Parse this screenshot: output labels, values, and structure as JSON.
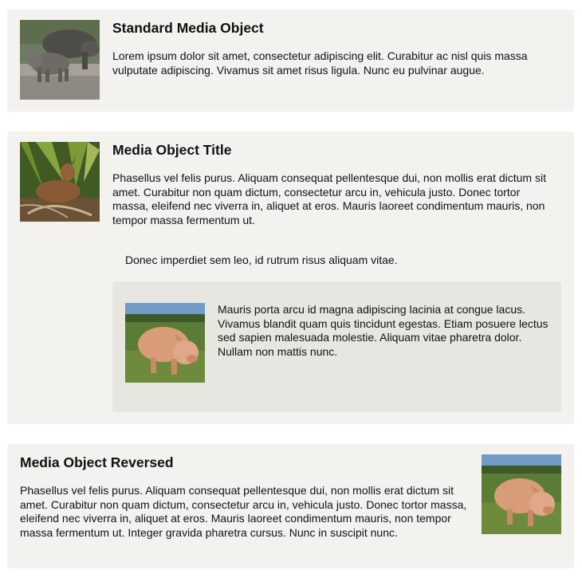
{
  "media1": {
    "title": "Standard Media Object",
    "body": "Lorem ipsum dolor sit amet, consectetur adipiscing elit. Curabitur ac nisl quis massa vulputate adipiscing. Vivamus sit amet risus ligula. Nunc eu pulvinar augue.",
    "image": "rhino-photo"
  },
  "media2": {
    "title": "Media Object Title",
    "body": "Phasellus vel felis purus. Aliquam consequat pellentesque dui, non mollis erat dictum sit amet. Curabitur non quam dictum, consectetur arcu in, vehicula justo. Donec tortor massa, eleifend nec viverra in, aliquet at eros. Mauris laoreet condimentum mauris, non tempor massa fermentum ut.",
    "extra": "Donec imperdiet sem leo, id rutrum risus aliquam vitae.",
    "image": "deer-photo",
    "nested": {
      "body": "Mauris porta arcu id magna adipiscing lacinia at congue lacus. Vivamus blandit quam quis tincidunt egestas. Etiam posuere lectus sed sapien malesuada molestie. Aliquam vitae pharetra dolor. Nullam non mattis nunc.",
      "image": "pig-photo"
    }
  },
  "media3": {
    "title": "Media Object Reversed",
    "body": "Phasellus vel felis purus. Aliquam consequat pellentesque dui, non mollis erat dictum sit amet. Curabitur non quam dictum, consectetur arcu in, vehicula justo. Donec tortor massa, eleifend nec viverra in, aliquet at eros. Mauris laoreet condimentum mauris, non tempor massa fermentum ut. Integer gravida pharetra cursus. Nunc in suscipit nunc.",
    "image": "pig-photo"
  }
}
